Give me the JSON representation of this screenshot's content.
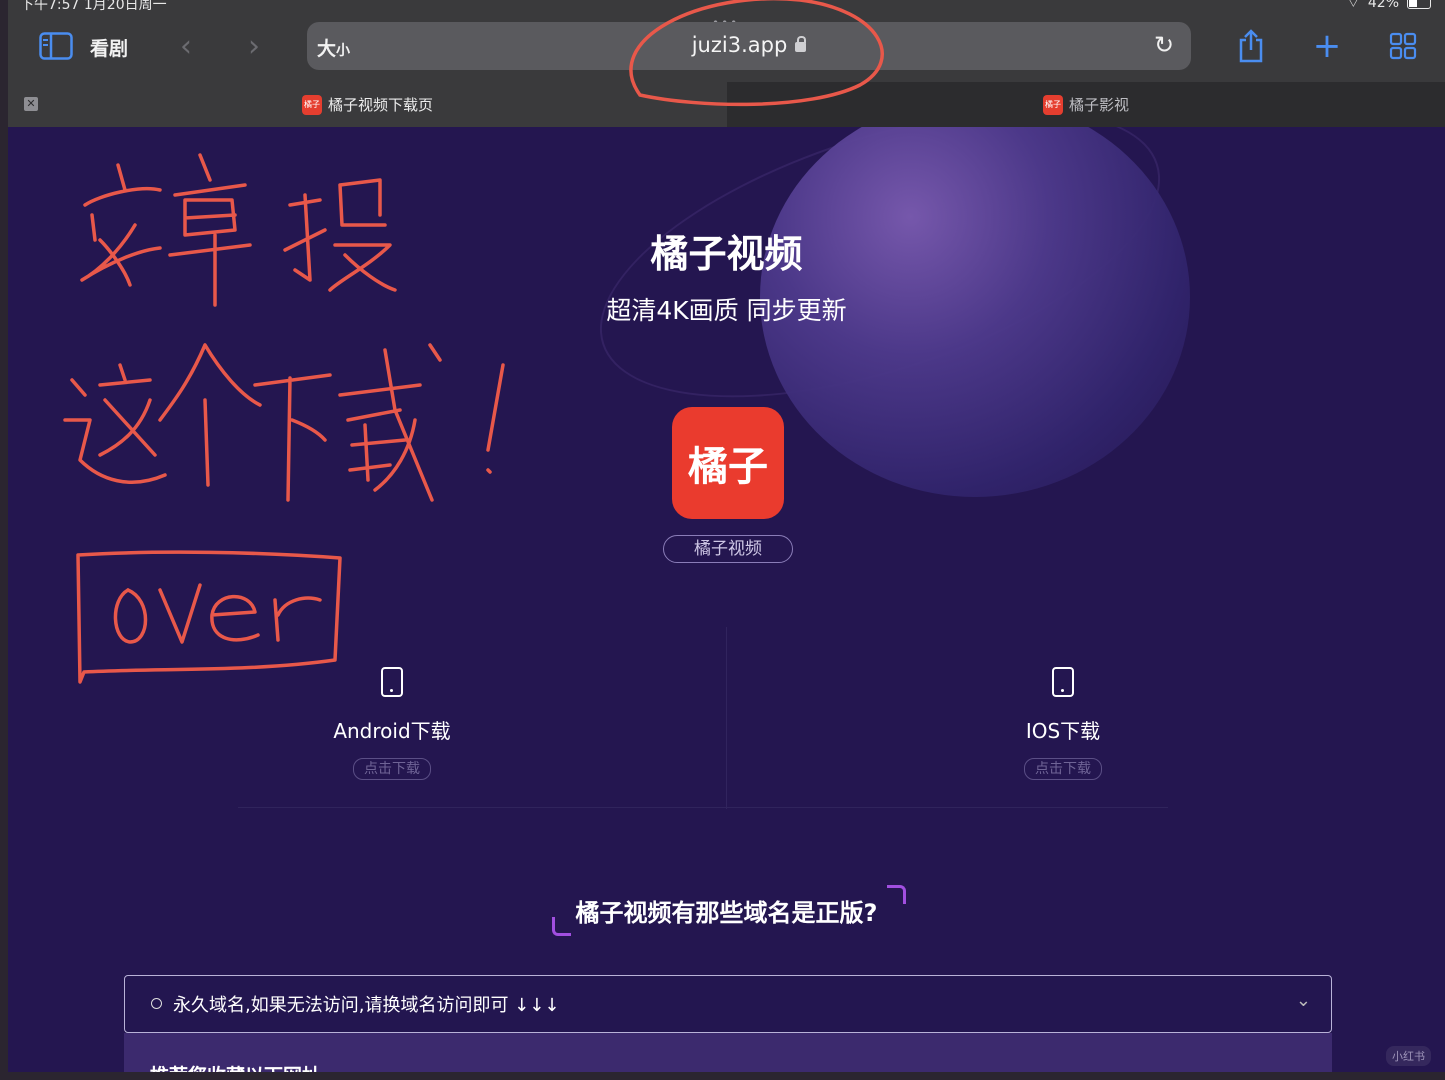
{
  "status": {
    "time_date": "下午7:57  1月20日周一",
    "battery": "42%",
    "battery_level": 0.42
  },
  "toolbar": {
    "site_label": "看剧",
    "text_size_big": "大",
    "text_size_small": "小",
    "url": "juzi3.app"
  },
  "tabs": [
    {
      "favicon": "橘子",
      "title": "橘子视频下载页"
    },
    {
      "favicon": "橘子",
      "title": "橘子影视"
    }
  ],
  "hero": {
    "title": "橘子视频",
    "subtitle": "超清4K画质 同步更新",
    "app_icon_text": "橘子",
    "app_name": "橘子视频"
  },
  "downloads": [
    {
      "label": "Android下载",
      "button": "点击下载",
      "icon": "phone-icon"
    },
    {
      "label": "IOS下载",
      "button": "点击下载",
      "icon": "phone-icon"
    }
  ],
  "faq": {
    "question": "橘子视频有那些域名是正版?",
    "accordion_label": "永久域名,如果无法访问,请换域名访问即可 ↓↓↓",
    "panel_text": "推荐您收藏以下网址"
  },
  "annotation": {
    "line1": "安卓搜",
    "line2": "这个下载!",
    "boxed": "over",
    "color": "#e8584a"
  },
  "watermark": "小红书",
  "colors": {
    "page_bg": "#241650",
    "app_icon": "#ea3b2e",
    "accent_bracket": "#a14fe0",
    "safari_blue": "#4a8df0"
  }
}
